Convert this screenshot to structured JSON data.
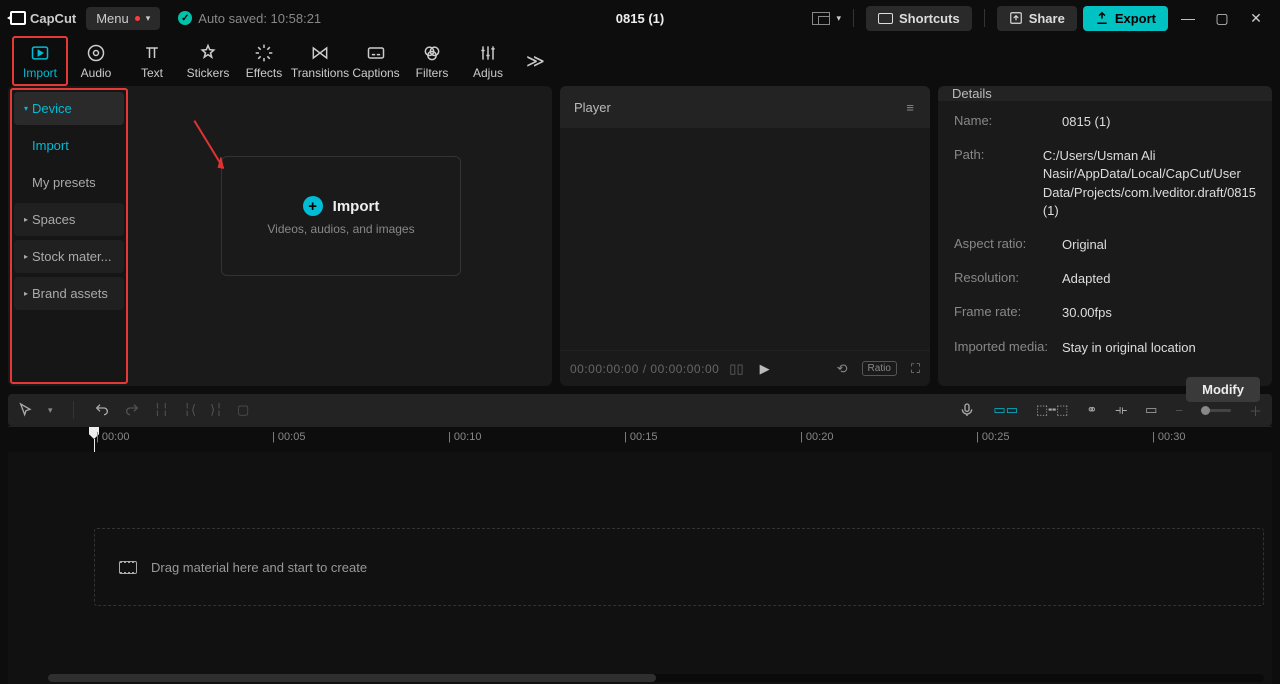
{
  "app": {
    "name": "CapCut",
    "project_title": "0815 (1)"
  },
  "menu": {
    "label": "Menu"
  },
  "autosave": {
    "text": "Auto saved: 10:58:21"
  },
  "titlebar": {
    "shortcuts": "Shortcuts",
    "share": "Share",
    "export": "Export"
  },
  "tabs": {
    "import": "Import",
    "audio": "Audio",
    "text": "Text",
    "stickers": "Stickers",
    "effects": "Effects",
    "transitions": "Transitions",
    "captions": "Captions",
    "filters": "Filters",
    "adjust": "Adjus"
  },
  "sidebar": {
    "device": "Device",
    "import": "Import",
    "mypresets": "My presets",
    "spaces": "Spaces",
    "stock": "Stock mater...",
    "brand": "Brand assets"
  },
  "import_box": {
    "title": "Import",
    "subtitle": "Videos, audios, and images"
  },
  "player": {
    "title": "Player",
    "timecode": "00:00:00:00 / 00:00:00:00",
    "ratio_label": "Ratio"
  },
  "details": {
    "title": "Details",
    "name_lab": "Name:",
    "name_val": "0815 (1)",
    "path_lab": "Path:",
    "path_val": "C:/Users/Usman Ali Nasir/AppData/Local/CapCut/User Data/Projects/com.lveditor.draft/0815 (1)",
    "aspect_lab": "Aspect ratio:",
    "aspect_val": "Original",
    "res_lab": "Resolution:",
    "res_val": "Adapted",
    "fps_lab": "Frame rate:",
    "fps_val": "30.00fps",
    "imp_lab": "Imported media:",
    "imp_val": "Stay in original location",
    "modify": "Modify"
  },
  "timeline": {
    "ticks": [
      "00:00",
      "00:05",
      "00:10",
      "00:15",
      "00:20",
      "00:25",
      "00:30"
    ],
    "drop_hint": "Drag material here and start to create"
  }
}
